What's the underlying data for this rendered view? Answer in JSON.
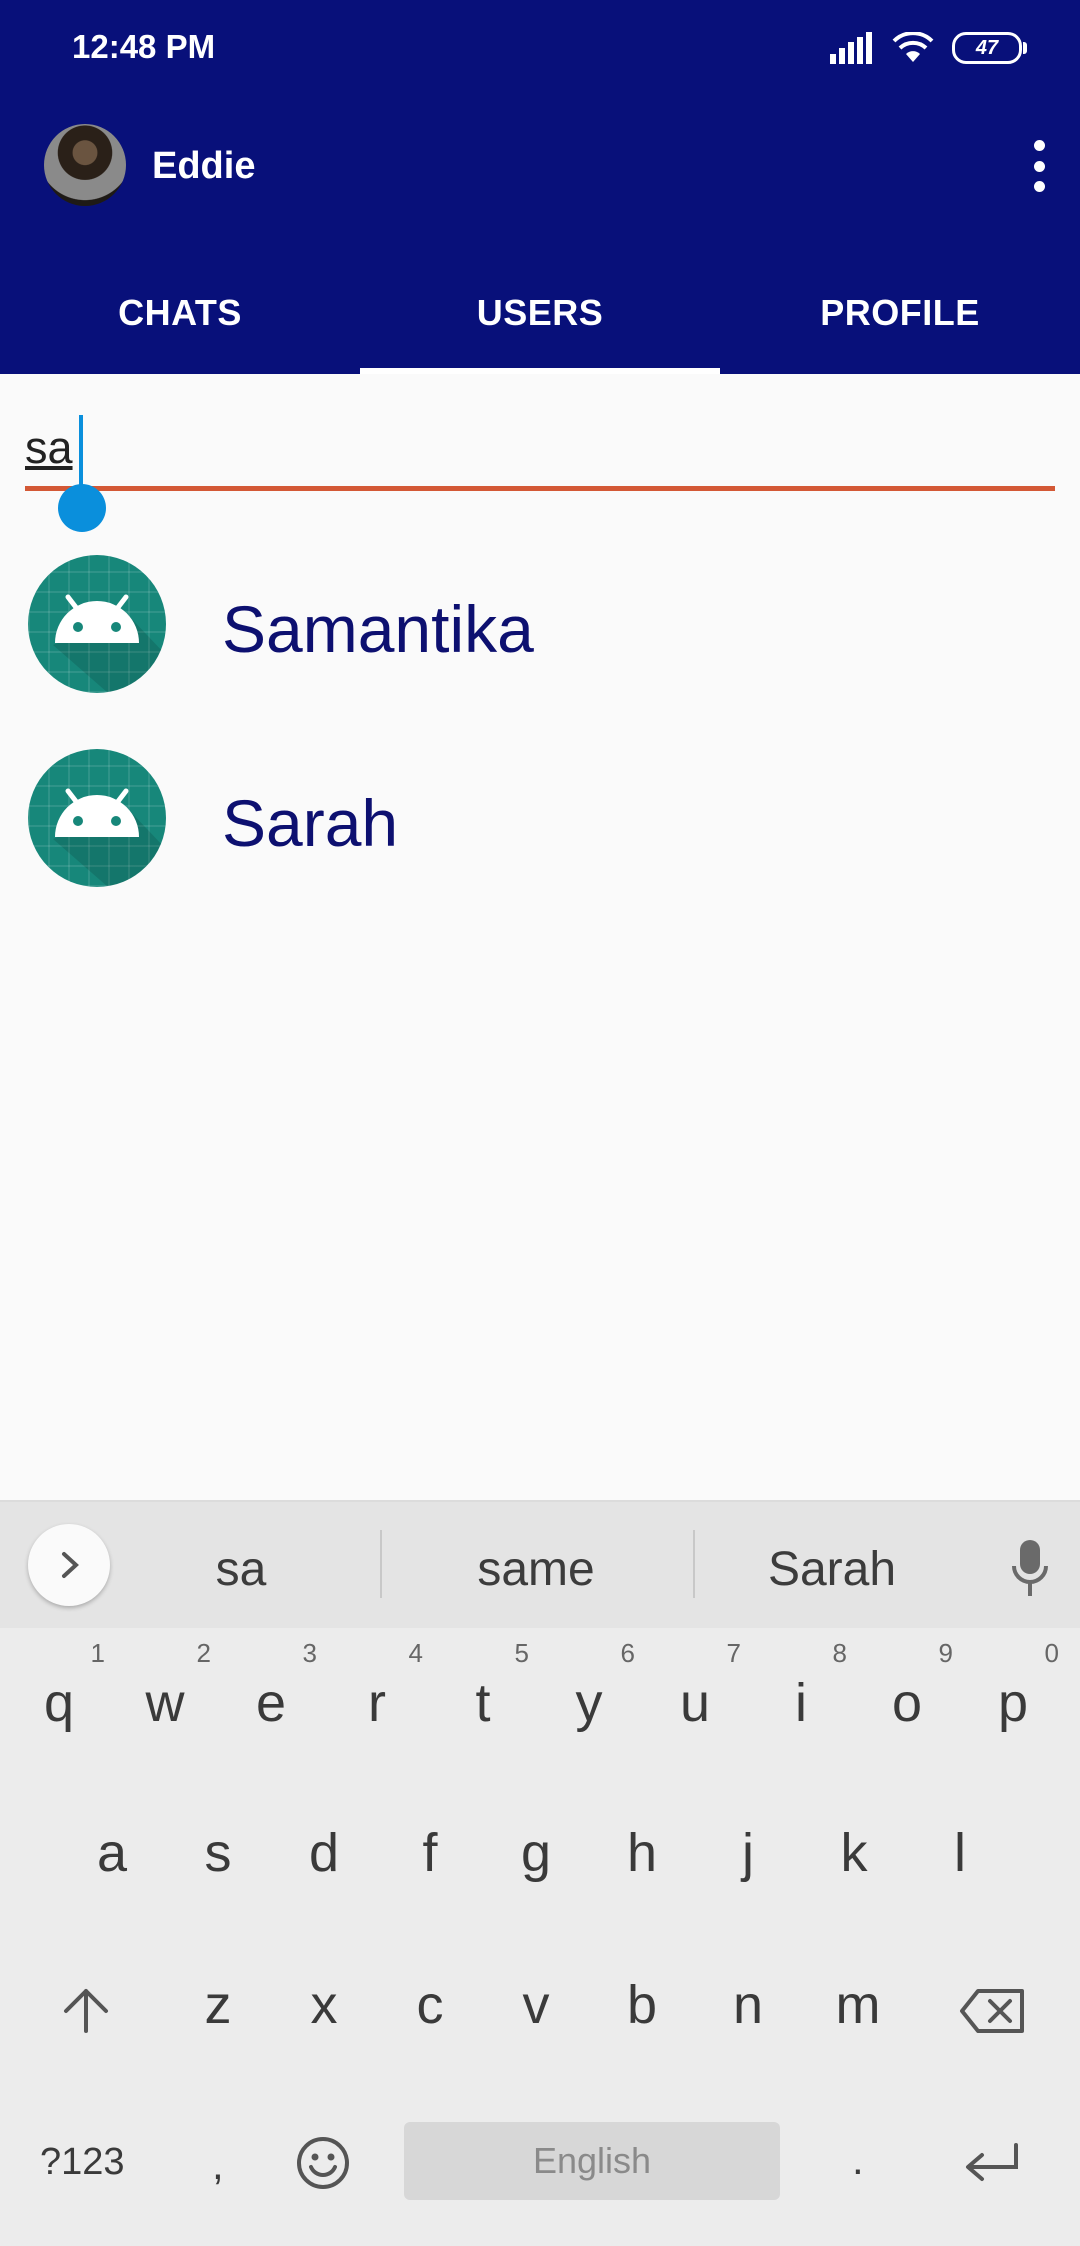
{
  "status": {
    "time": "12:48 PM",
    "battery": "47"
  },
  "header": {
    "username": "Eddie"
  },
  "tabs": [
    {
      "label": "CHATS"
    },
    {
      "label": "USERS"
    },
    {
      "label": "PROFILE"
    }
  ],
  "search": {
    "value": "sa"
  },
  "users": [
    {
      "name": "Samantika"
    },
    {
      "name": "Sarah"
    }
  ],
  "keyboard": {
    "suggestions": [
      "sa",
      "same",
      "Sarah"
    ],
    "row1": [
      "q",
      "w",
      "e",
      "r",
      "t",
      "y",
      "u",
      "i",
      "o",
      "p"
    ],
    "row1_digits": [
      "1",
      "2",
      "3",
      "4",
      "5",
      "6",
      "7",
      "8",
      "9",
      "0"
    ],
    "row2": [
      "a",
      "s",
      "d",
      "f",
      "g",
      "h",
      "j",
      "k",
      "l"
    ],
    "row3": [
      "z",
      "x",
      "c",
      "v",
      "b",
      "n",
      "m"
    ],
    "symbols_label": "?123",
    "comma": ",",
    "period": ".",
    "space_label": "English"
  },
  "colors": {
    "appbar": "#08107a",
    "accent_line": "#d35835",
    "cursor": "#0a8fdc",
    "avatar_bg": "#17877a",
    "user_name": "#0d1070"
  }
}
